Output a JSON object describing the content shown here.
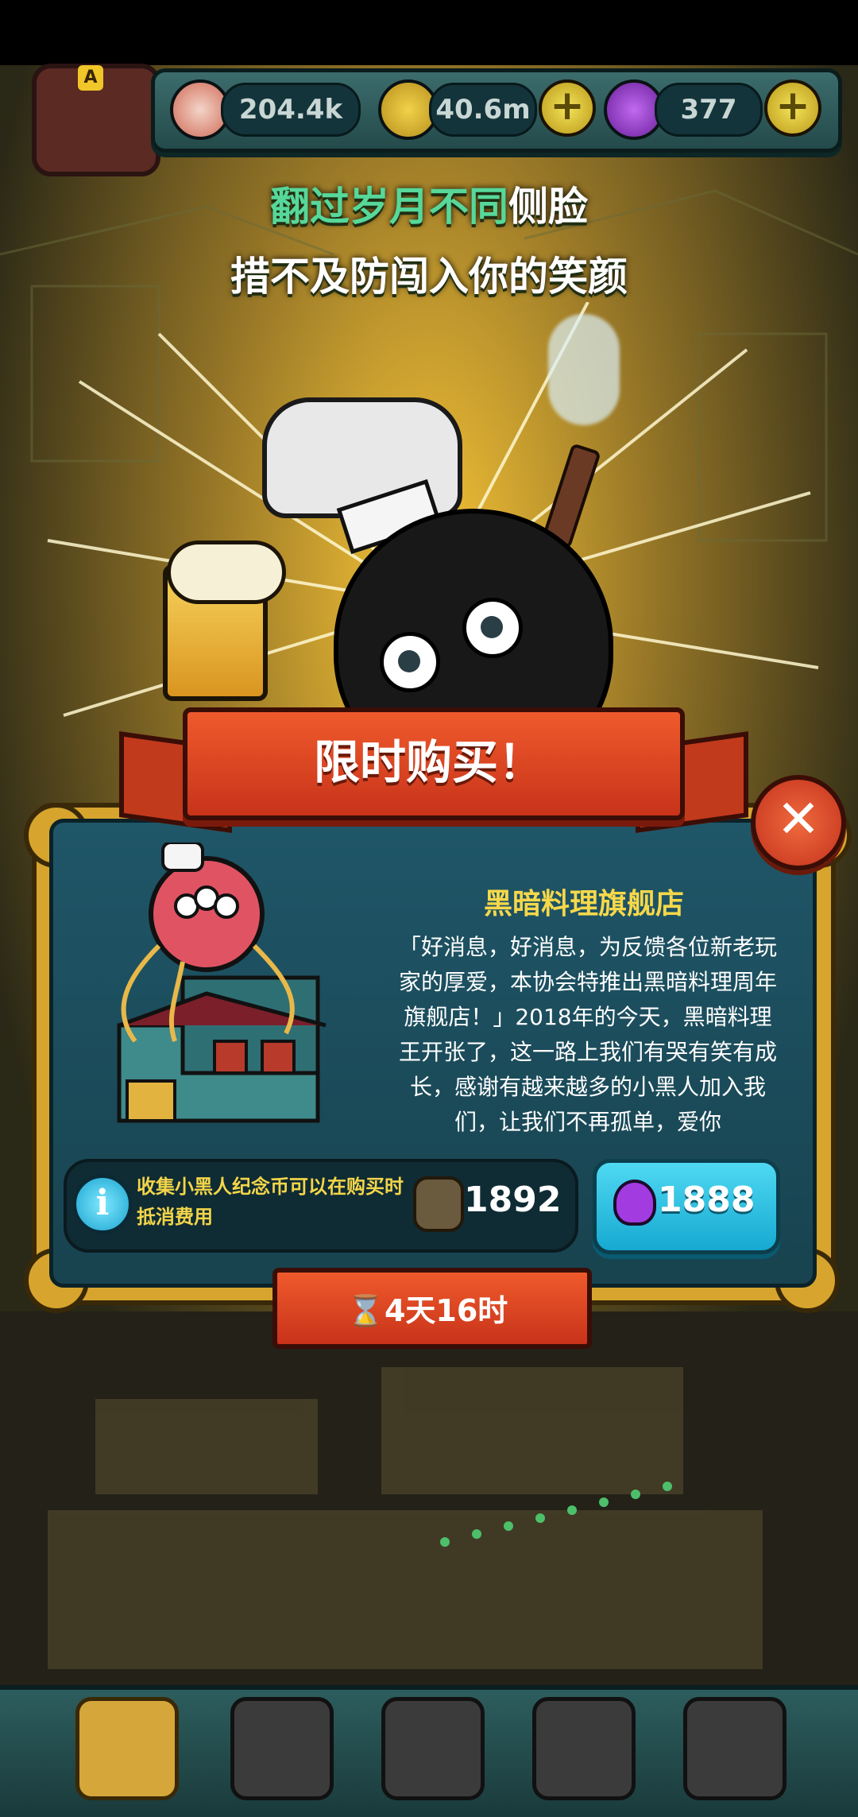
{
  "hud": {
    "eyes": "204.4k",
    "coins": "40.6m",
    "potions": "377",
    "avatar_badge": "A",
    "plus": "+"
  },
  "slogan": {
    "line1_green": "翻过岁月不同",
    "line1_white": "侧脸",
    "line2": "措不及防闯入你的笑颜"
  },
  "popup": {
    "title": "限时购买！",
    "close": "✕",
    "shop_name": "黑暗料理旗舰店",
    "description": "「好消息，好消息，为反馈各位新老玩家的厚爱，本协会特推出黑暗料理周年旗舰店！」2018年的今天，黑暗料理王开张了，这一路上我们有哭有笑有成长，感谢有越来越多的小黑人加入我们，让我们不再孤单，爱你",
    "info_icon": "i",
    "info_text": "收集小黑人纪念币可以在购买时抵消费用",
    "coin_count": "1892",
    "price": "1888",
    "timer": "⌛4天16时"
  },
  "colors": {
    "accent_gold": "#f7d84a",
    "panel_teal": "#1f5668",
    "banner_red": "#e24a26",
    "button_cyan": "#2fc3e6"
  },
  "icons": {
    "eye_currency": "eyeball-icon",
    "coin_currency": "coin-icon",
    "potion_currency": "potion-icon",
    "close": "close-icon",
    "info": "info-icon",
    "timer": "hourglass-icon"
  }
}
